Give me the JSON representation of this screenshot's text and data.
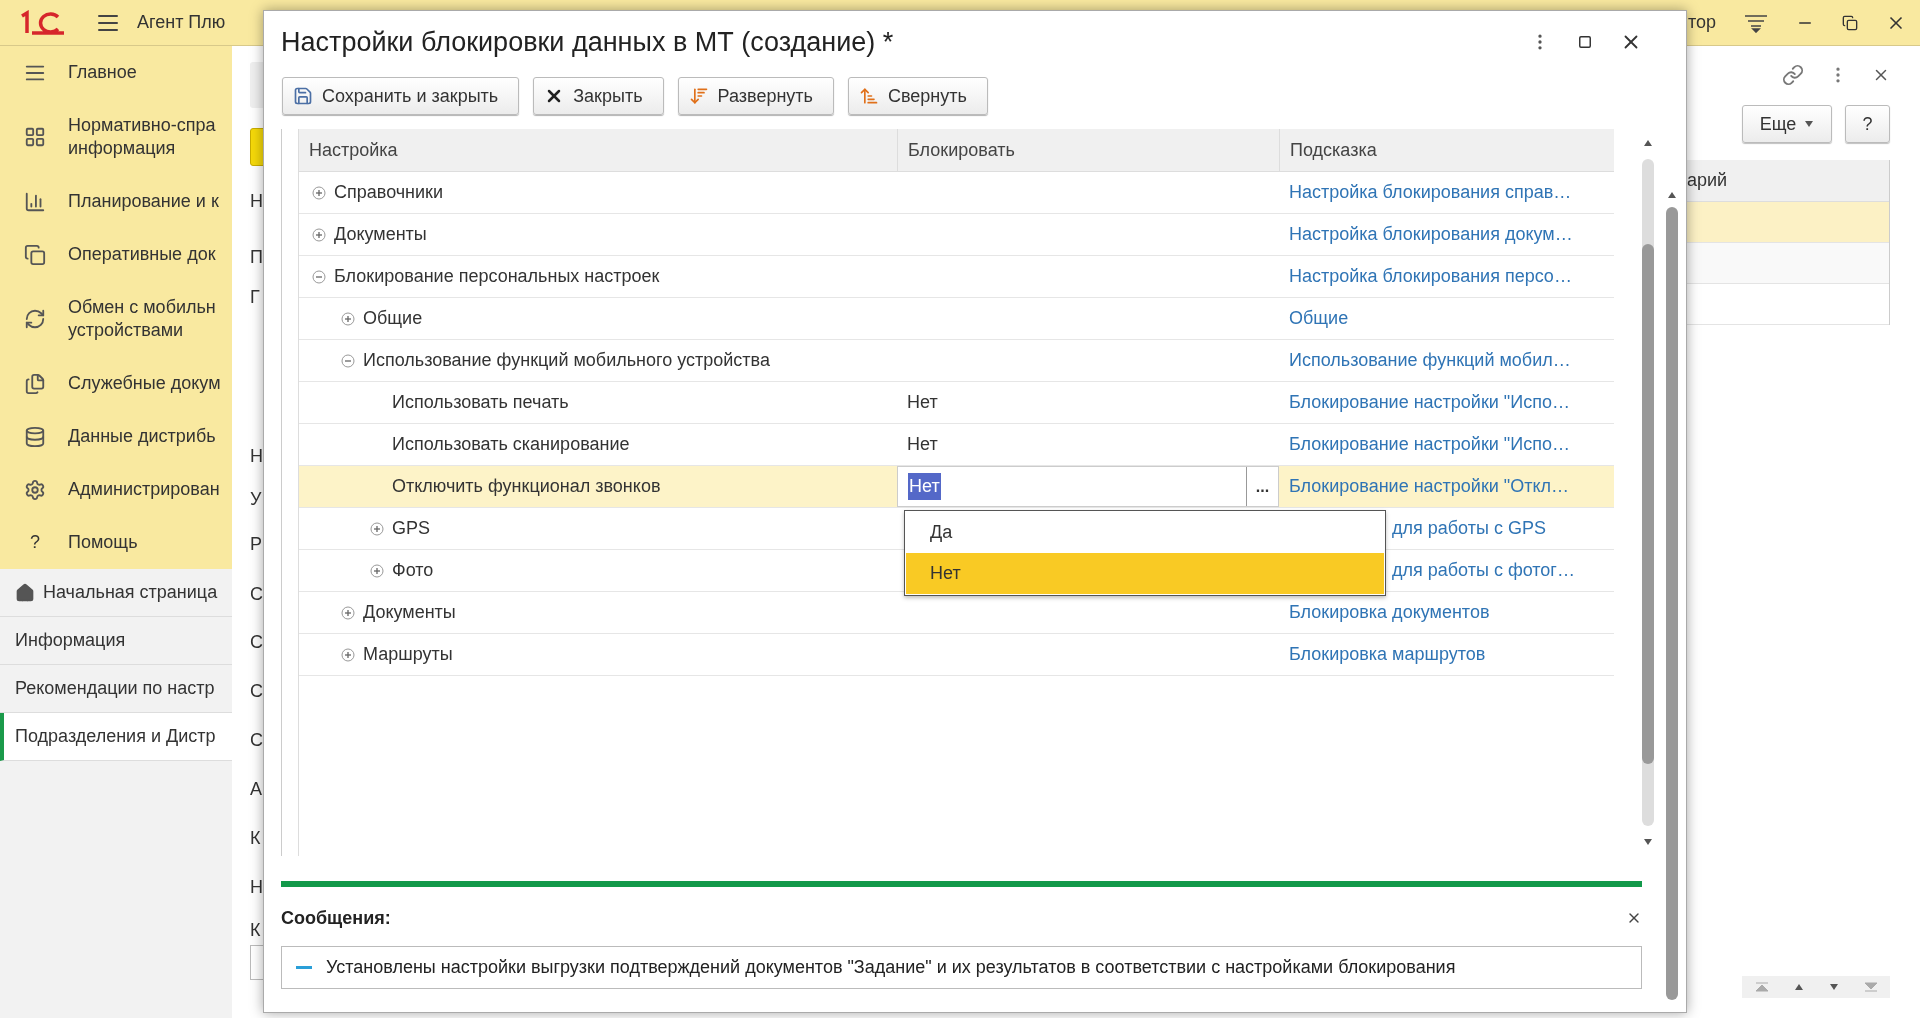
{
  "app": {
    "title": "Агент Плю",
    "sections": [
      {
        "label": "Главное",
        "kind": "list"
      },
      {
        "label": "Нормативно-спра\nинформация",
        "kind": "grid"
      },
      {
        "label": "Планирование и к",
        "kind": "chart"
      },
      {
        "label": "Оперативные док",
        "kind": "copy"
      },
      {
        "label": "Обмен с мобильн\nустройствами",
        "kind": "sync"
      },
      {
        "label": "Служебные докум",
        "kind": "docs"
      },
      {
        "label": "Данные дистрибь",
        "kind": "data"
      },
      {
        "label": "Администрирован",
        "kind": "gear"
      },
      {
        "label": "Помощь",
        "kind": "help",
        "glyph": "?"
      }
    ],
    "tabs": [
      {
        "label": "Начальная страница",
        "kind": "home",
        "selected": false
      },
      {
        "label": "Информация",
        "kind": "page",
        "selected": false
      },
      {
        "label": "Рекомендации по настр",
        "kind": "page",
        "selected": false
      },
      {
        "label": "Подразделения и Дистр",
        "kind": "page",
        "selected": true
      }
    ]
  },
  "background_form": {
    "letters": [
      "Н",
      "П",
      "Г",
      "Н",
      "У",
      "Р",
      "С",
      "С",
      "С",
      "С",
      "А",
      "К",
      "Н",
      "К"
    ]
  },
  "right_panel": {
    "title_fragment": "тор",
    "more_button": "Еще",
    "help_button": "?",
    "column_fragment": "арий",
    "rows": [
      {
        "selected": true
      },
      {
        "selected": false
      },
      {
        "selected": false
      }
    ]
  },
  "dialog": {
    "title": "Настройки блокировки данных в МТ (создание) *",
    "buttons": [
      {
        "label": "Сохранить и закрыть",
        "kind": "save"
      },
      {
        "label": "Закрыть",
        "kind": "close"
      },
      {
        "label": "Развернуть",
        "kind": "expand"
      },
      {
        "label": "Свернуть",
        "kind": "collapse"
      }
    ],
    "table": {
      "columns": [
        "Настройка",
        "Блокировать",
        "Подсказка"
      ],
      "rows": [
        {
          "name": "Справочники",
          "hint": "Настройка блокирования справ…",
          "expanded": false,
          "selected": false
        },
        {
          "name": "Документы",
          "hint": "Настройка блокирования докум…",
          "expanded": false,
          "selected": false
        },
        {
          "name": "Блокирование персональных настроек",
          "hint": "Настройка блокирования персо…",
          "expanded": true,
          "selected": false,
          "children": [
            {
              "name": "Общие",
              "hint": "Общие",
              "expanded": false,
              "selected": false
            },
            {
              "name": "Использование функций мобильного устройства",
              "hint": "Использование функций мобил…",
              "expanded": true,
              "selected": false,
              "children": [
                {
                  "name": "Использовать печать",
                  "value": "Нет",
                  "hint": "Блокирование настройки \"Испо…",
                  "selected": false
                },
                {
                  "name": "Использовать сканирование",
                  "value": "Нет",
                  "hint": "Блокирование настройки \"Испо…",
                  "selected": false
                },
                {
                  "name": "Отключить функционал звонков",
                  "value": "Нет",
                  "hint": "Блокирование настройки \"Откл…",
                  "selected": true,
                  "button": "..."
                },
                {
                  "name": "GPS",
                  "hint": "для работы с GPS",
                  "expanded": false,
                  "selected": false
                },
                {
                  "name": "Фото",
                  "hint": "для работы с фотог…",
                  "expanded": false,
                  "selected": false
                }
              ]
            },
            {
              "name": "Документы",
              "hint": "Блокировка документов",
              "expanded": false,
              "selected": false
            },
            {
              "name": "Маршруты",
              "hint": "Блокировка маршрутов",
              "expanded": false,
              "selected": false
            }
          ]
        }
      ]
    },
    "dropdown": {
      "options": [
        {
          "label": "Да",
          "selected": false
        },
        {
          "label": "Нет",
          "selected": true
        }
      ]
    },
    "messages": {
      "title": "Сообщения:",
      "items": [
        "Установлены настройки выгрузки подтверждений документов \"Задание\" и их результатов в соответствии с настройками блокирования"
      ]
    }
  }
}
